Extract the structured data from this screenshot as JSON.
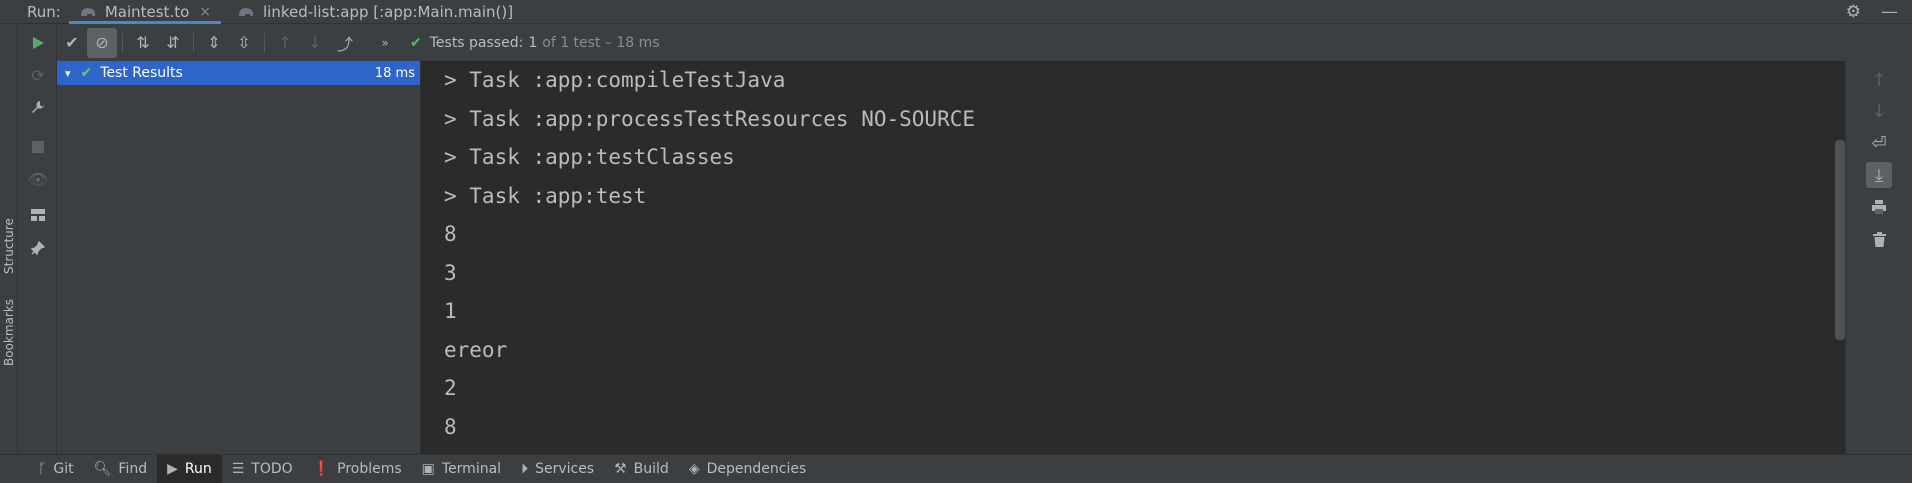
{
  "tabbar": {
    "run_label": "Run:",
    "tabs": [
      {
        "label": "Maintest.to",
        "active": true,
        "close": "×"
      },
      {
        "label": "linked-list:app [:app:Main.main()]",
        "active": false
      }
    ],
    "settings_icon": "⚙",
    "minimize_icon": "—"
  },
  "left_strip": {
    "structure_label": "Structure",
    "bookmarks_label": "Bookmarks"
  },
  "tool_column": {
    "icons": [
      "run-icon",
      "rerun-failed-icon",
      "wrench-icon",
      "stop-icon",
      "eye-icon",
      "layout-icon",
      "pin-icon"
    ]
  },
  "toolbar": {
    "icons": [
      "check-icon",
      "ignored-icon",
      "sort-alpha-icon",
      "sort-duration-icon",
      "expand-all-icon",
      "collapse-all-icon",
      "prev-icon",
      "next-icon",
      "export-icon",
      "more-icon"
    ],
    "status": {
      "passed_label": "Tests passed:",
      "passed_count": "1",
      "detail": "of 1 test – 18 ms"
    }
  },
  "tree": {
    "root": {
      "label": "Test Results",
      "time": "18 ms"
    }
  },
  "console": {
    "lines": [
      "> Task :app:compileTestJava",
      "> Task :app:processTestResources NO-SOURCE",
      "> Task :app:testClasses",
      "> Task :app:test",
      "8",
      "3",
      "1",
      "ereor",
      "2",
      "8"
    ]
  },
  "right_column": {
    "icons": [
      "up-arrow-icon",
      "down-arrow-icon",
      "soft-wrap-icon",
      "scroll-to-end-icon",
      "print-icon",
      "trash-icon"
    ]
  },
  "bottombar": {
    "tabs": [
      {
        "label": "Git",
        "icon": "git-branch-icon"
      },
      {
        "label": "Find",
        "icon": "find-icon"
      },
      {
        "label": "Run",
        "icon": "run-icon",
        "active": true
      },
      {
        "label": "TODO",
        "icon": "todo-icon"
      },
      {
        "label": "Problems",
        "icon": "problems-icon"
      },
      {
        "label": "Terminal",
        "icon": "terminal-icon"
      },
      {
        "label": "Services",
        "icon": "services-icon"
      },
      {
        "label": "Build",
        "icon": "build-icon"
      },
      {
        "label": "Dependencies",
        "icon": "dependencies-icon"
      }
    ]
  }
}
